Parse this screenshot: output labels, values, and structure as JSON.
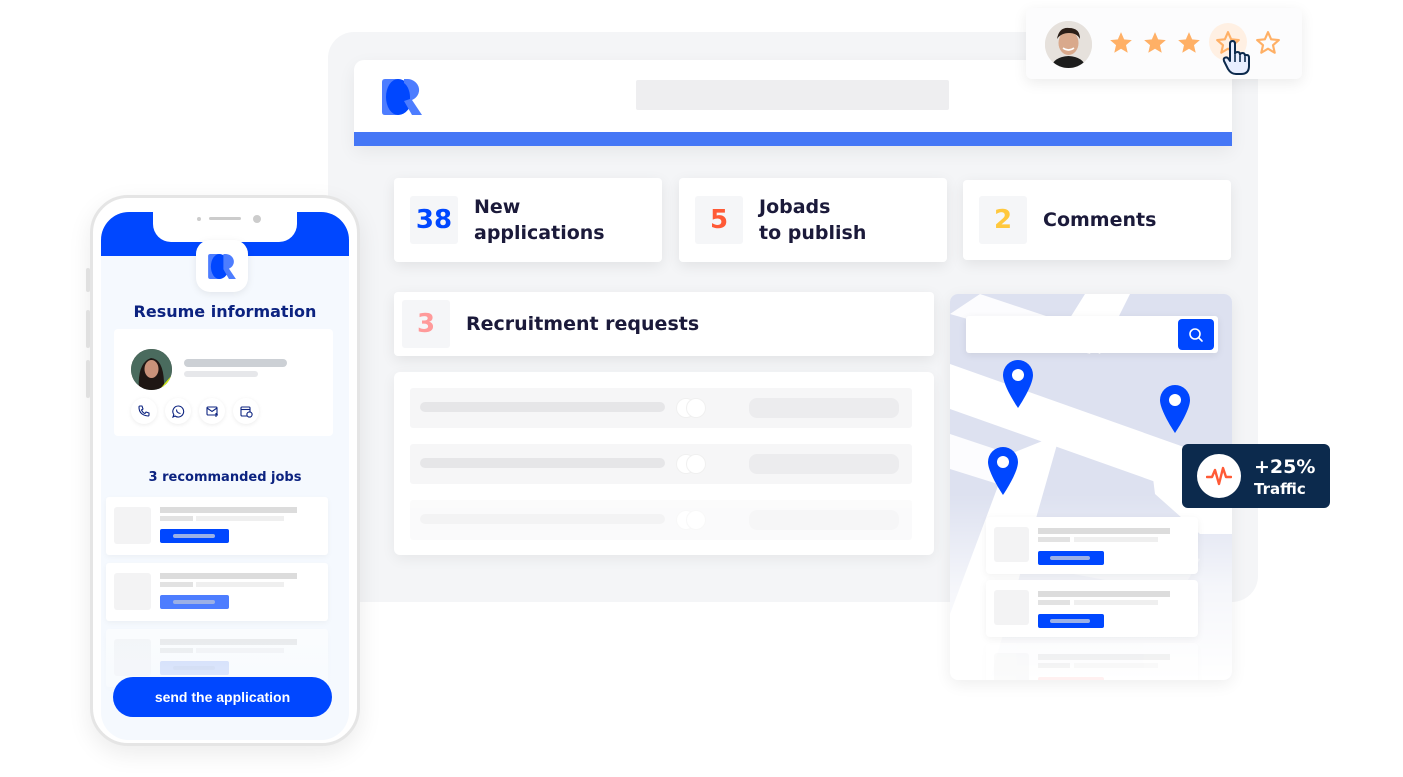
{
  "dashboard": {
    "brand_color": "#0047ff",
    "accent_bar_color": "#4577f6",
    "stats": [
      {
        "number": "38",
        "label_line1": "New",
        "label_line2": "applications",
        "color": "#0047ff"
      },
      {
        "number": "5",
        "label_line1": "Jobads",
        "label_line2": "to publish",
        "color": "#ff5a36"
      },
      {
        "number": "2",
        "label_line1": "Comments",
        "label_line2": "",
        "color": "#ffc83d"
      }
    ],
    "recruitment": {
      "number": "3",
      "label": "Recruitment requests",
      "color": "#ff9a9a"
    }
  },
  "map": {
    "search_placeholder": "",
    "search_icon": "magnifier"
  },
  "traffic_badge": {
    "value": "+25%",
    "label": "Traffic",
    "icon": "pulse-icon",
    "bg_color": "#0c2a4d",
    "icon_color": "#ff5a36"
  },
  "rating": {
    "value": 3,
    "max": 5,
    "hovered_star": 4,
    "star_color": "#ffb066"
  },
  "phone": {
    "title": "Resume information",
    "contact_icons": [
      "phone-icon",
      "whatsapp-icon",
      "mail-add-icon",
      "calendar-icon"
    ],
    "jobs_title": "3 recommanded jobs",
    "cta_label": "send the application"
  }
}
